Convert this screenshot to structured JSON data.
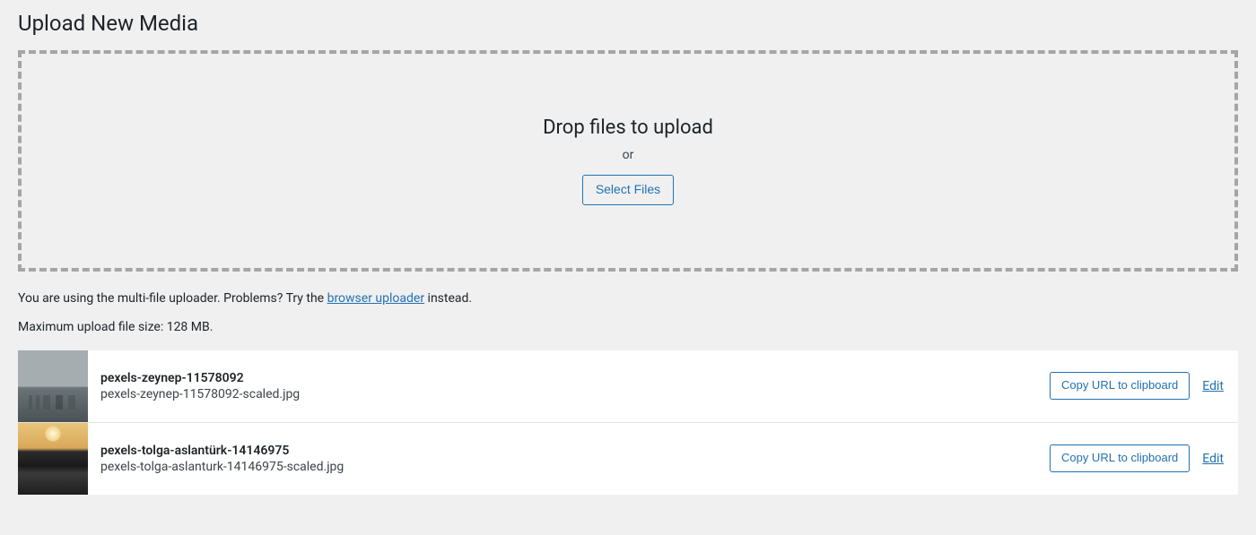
{
  "page": {
    "title": "Upload New Media"
  },
  "dropzone": {
    "heading": "Drop files to upload",
    "or": "or",
    "button": "Select Files"
  },
  "uploader_note": {
    "prefix": "You are using the multi-file uploader. Problems? Try the ",
    "link": "browser uploader",
    "suffix": " instead."
  },
  "max_size": "Maximum upload file size: 128 MB.",
  "actions": {
    "copy": "Copy URL to clipboard",
    "edit": "Edit"
  },
  "items": [
    {
      "name": "pexels-zeynep-11578092",
      "file": "pexels-zeynep-11578092-scaled.jpg"
    },
    {
      "name": "pexels-tolga-aslantürk-14146975",
      "file": "pexels-tolga-aslanturk-14146975-scaled.jpg"
    }
  ]
}
